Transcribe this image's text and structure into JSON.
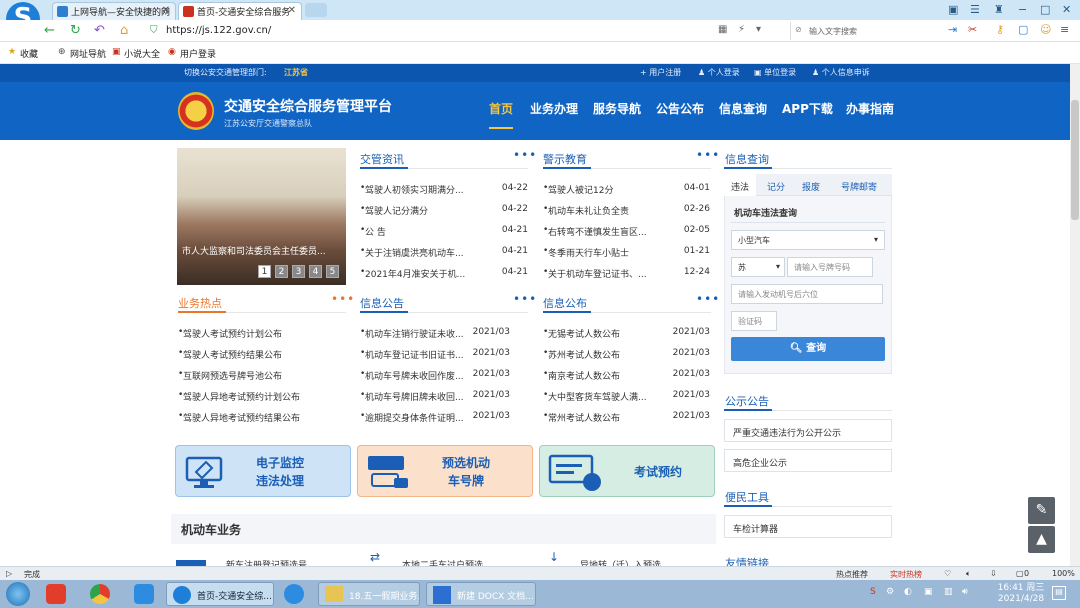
{
  "browser": {
    "tabs": [
      {
        "title": "上网导航—安全快捷的网",
        "active": false
      },
      {
        "title": "首页-交通安全综合服务",
        "active": true
      }
    ],
    "url": "https://js.122.gov.cn/",
    "search_placeholder": "输入文字搜索",
    "bookmarks": [
      "收藏",
      "网址导航",
      "小说大全",
      "用户登录"
    ]
  },
  "site": {
    "top_strip": {
      "switch_label": "切换公安交通管理部门:",
      "province": "江苏省",
      "links": [
        "用户注册",
        "个人登录",
        "单位登录",
        "个人信息申诉"
      ]
    },
    "title": "交通安全综合服务管理平台",
    "subtitle": "江苏公安厅交通警察总队",
    "nav": [
      "首页",
      "业务办理",
      "服务导航",
      "公告公布",
      "信息查询",
      "APP下载",
      "办事指南"
    ],
    "banner": {
      "caption": "市人大监察和司法委员会主任委员...",
      "pages": [
        "1",
        "2",
        "3",
        "4",
        "5"
      ]
    },
    "news": {
      "title": "交管资讯",
      "items": [
        {
          "text": "驾驶人初领实习期满分...",
          "date": "04-22"
        },
        {
          "text": "驾驶人记分满分",
          "date": "04-22"
        },
        {
          "text": "公 告",
          "date": "04-21"
        },
        {
          "text": "关于注销虞洪亮机动车...",
          "date": "04-21"
        },
        {
          "text": "2021年4月准安关于机...",
          "date": "04-21"
        }
      ]
    },
    "warning": {
      "title": "警示教育",
      "items": [
        {
          "text": "驾驶人被记12分",
          "date": "04-01"
        },
        {
          "text": "机动车未礼让负全责",
          "date": "02-26"
        },
        {
          "text": "右转弯不谨慎发生盲区...",
          "date": "02-05"
        },
        {
          "text": "冬季雨天行车小贴士",
          "date": "01-21"
        },
        {
          "text": "关于机动车登记证书、...",
          "date": "12-24"
        }
      ]
    },
    "hot": {
      "title": "业务热点",
      "items": [
        "驾驶人考试预约计划公布",
        "驾驶人考试预约结果公布",
        "互联网预选号牌号池公布",
        "驾驶人异地考试预约计划公布",
        "驾驶人异地考试预约结果公布"
      ]
    },
    "info_notice": {
      "title": "信息公告",
      "items": [
        {
          "text": "机动车注销行驶证未收...",
          "date": "2021/03"
        },
        {
          "text": "机动车登记证书旧证书...",
          "date": "2021/03"
        },
        {
          "text": "机动车号牌未收回作废...",
          "date": "2021/03"
        },
        {
          "text": "机动车号牌旧牌未收回...",
          "date": "2021/03"
        },
        {
          "text": "逾期提交身体条件证明...",
          "date": "2021/03"
        }
      ]
    },
    "info_publish": {
      "title": "信息公布",
      "items": [
        {
          "text": "无锡考试人数公布",
          "date": "2021/03"
        },
        {
          "text": "苏州考试人数公布",
          "date": "2021/03"
        },
        {
          "text": "南京考试人数公布",
          "date": "2021/03"
        },
        {
          "text": "大中型客货车驾驶人满...",
          "date": "2021/03"
        },
        {
          "text": "常州考试人数公布",
          "date": "2021/03"
        }
      ]
    },
    "cards": [
      {
        "line1": "电子监控",
        "line2": "违法处理"
      },
      {
        "line1": "预选机动",
        "line2": "车号牌"
      },
      {
        "line1": "考试预约",
        "line2": ""
      }
    ],
    "motor_section": "机动车业务",
    "motor_items": [
      "新车注册登记预选号",
      "本地二手车过户预选",
      "异地转（迁）入预选"
    ],
    "query": {
      "title": "信息查询",
      "tabs": [
        "违法",
        "记分",
        "报废",
        "号牌邮寄"
      ],
      "subtitle": "机动车违法查询",
      "vehicle_type": "小型汽车",
      "plate_prefix": "苏",
      "plate_placeholder": "请输入号牌号码",
      "engine_placeholder": "请输入发动机号后六位",
      "captcha_placeholder": "验证码",
      "button": "查询"
    },
    "public_notice": {
      "title": "公示公告",
      "items": [
        "严重交通违法行为公开公示",
        "高危企业公示"
      ]
    },
    "tools": {
      "title": "便民工具",
      "items": [
        "车检计算器"
      ]
    },
    "links_title": "友情链接"
  },
  "statusbar": {
    "status": "完成",
    "right": [
      "热点推荐",
      "实时热榜",
      "0",
      "100%"
    ]
  },
  "taskbar": {
    "items": [
      "首页-交通安全综...",
      "18.五一假期业务...",
      "新建 DOCX 文档..."
    ],
    "time": "16:41 周三",
    "date": "2021/4/28"
  }
}
